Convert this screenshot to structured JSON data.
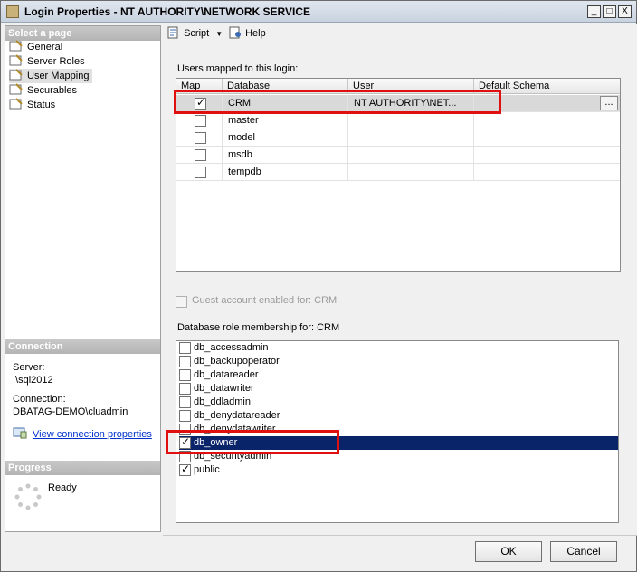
{
  "window": {
    "title": "Login Properties - NT AUTHORITY\\NETWORK SERVICE",
    "minimize": "_",
    "maximize": "□",
    "close": "X"
  },
  "left": {
    "select_page_header": "Select a page",
    "pages": [
      {
        "label": "General"
      },
      {
        "label": "Server Roles"
      },
      {
        "label": "User Mapping",
        "selected": true
      },
      {
        "label": "Securables"
      },
      {
        "label": "Status"
      }
    ],
    "connection_header": "Connection",
    "server_label": "Server:",
    "server_value": ".\\sql2012",
    "connection_label": "Connection:",
    "connection_value": "DBATAG-DEMO\\cluadmin",
    "view_connection_link": "View connection properties",
    "progress_header": "Progress",
    "progress_status": "Ready"
  },
  "toolbar": {
    "script_label": "Script",
    "help_label": "Help"
  },
  "mapping": {
    "label": "Users mapped to this login:",
    "columns": [
      "Map",
      "Database",
      "User",
      "Default Schema"
    ],
    "rows": [
      {
        "map": true,
        "database": "CRM",
        "user": "NT AUTHORITY\\NET...",
        "schema": "",
        "dots": "..."
      },
      {
        "map": false,
        "database": "master",
        "user": "",
        "schema": ""
      },
      {
        "map": false,
        "database": "model",
        "user": "",
        "schema": ""
      },
      {
        "map": false,
        "database": "msdb",
        "user": "",
        "schema": ""
      },
      {
        "map": false,
        "database": "tempdb",
        "user": "",
        "schema": ""
      }
    ]
  },
  "guest": {
    "label": "Guest account enabled for: CRM"
  },
  "roles": {
    "label": "Database role membership for: CRM",
    "items": [
      {
        "name": "db_accessadmin",
        "checked": false
      },
      {
        "name": "db_backupoperator",
        "checked": false
      },
      {
        "name": "db_datareader",
        "checked": false
      },
      {
        "name": "db_datawriter",
        "checked": false
      },
      {
        "name": "db_ddladmin",
        "checked": false
      },
      {
        "name": "db_denydatareader",
        "checked": false
      },
      {
        "name": "db_denydatawriter",
        "checked": false
      },
      {
        "name": "db_owner",
        "checked": true,
        "selected": true
      },
      {
        "name": "db_securityadmin",
        "checked": false
      },
      {
        "name": "public",
        "checked": true
      }
    ]
  },
  "buttons": {
    "ok": "OK",
    "cancel": "Cancel"
  },
  "colors": {
    "highlight": "#e01010",
    "selection": "#0a246a"
  }
}
